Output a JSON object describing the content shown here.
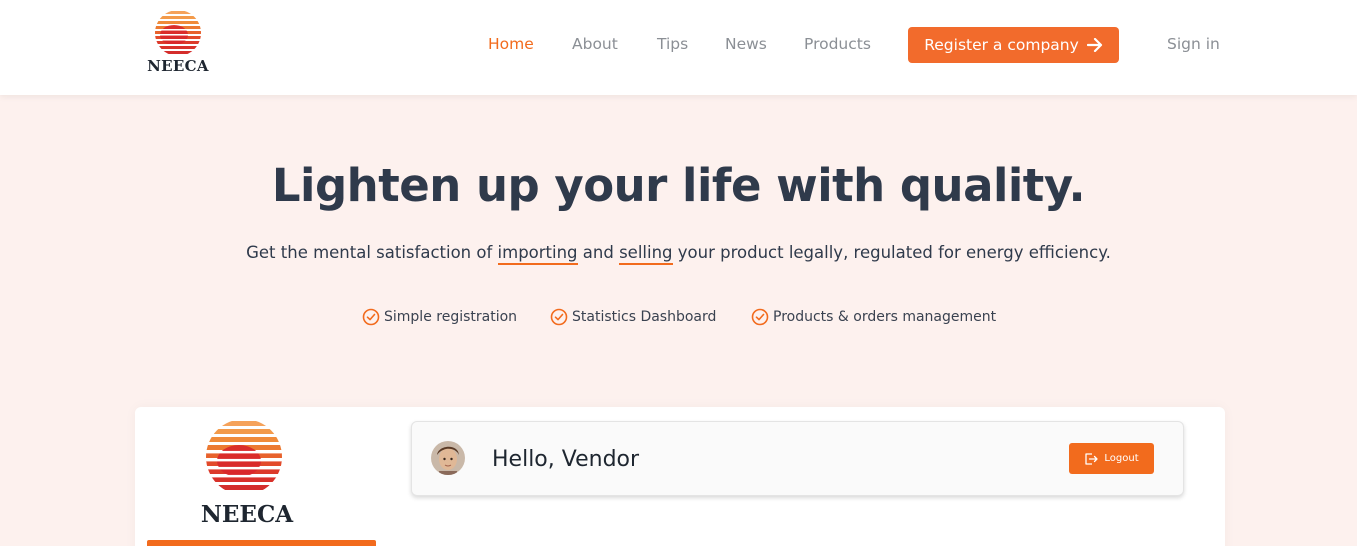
{
  "header": {
    "logo_text": "NEECA",
    "nav": [
      {
        "label": "Home",
        "active": true
      },
      {
        "label": "About",
        "active": false
      },
      {
        "label": "Tips",
        "active": false
      },
      {
        "label": "News",
        "active": false
      },
      {
        "label": "Products",
        "active": false
      }
    ],
    "register_label": "Register a company",
    "register_icon": "arrow-right-icon",
    "signin_label": "Sign in"
  },
  "hero": {
    "title": "Lighten up your life with quality.",
    "subtitle_part1": "Get the mental satisfaction of ",
    "subtitle_ul1": "importing",
    "subtitle_part2": " and ",
    "subtitle_ul2": "selling",
    "subtitle_part3": " your product legally, regulated for energy efficiency.",
    "features": [
      {
        "label": "Simple registration",
        "icon": "check-circle-icon"
      },
      {
        "label": "Statistics Dashboard",
        "icon": "check-circle-icon"
      },
      {
        "label": "Products & orders management",
        "icon": "check-circle-icon"
      }
    ]
  },
  "preview": {
    "logo_text": "NEECA",
    "greeting": "Hello, Vendor",
    "logout_label": "Logout",
    "logout_icon": "logout-icon"
  },
  "colors": {
    "accent": "#f26b1d",
    "background": "#fdf1ee",
    "text": "#2f3a4b",
    "nav_text": "#8b8f95"
  }
}
